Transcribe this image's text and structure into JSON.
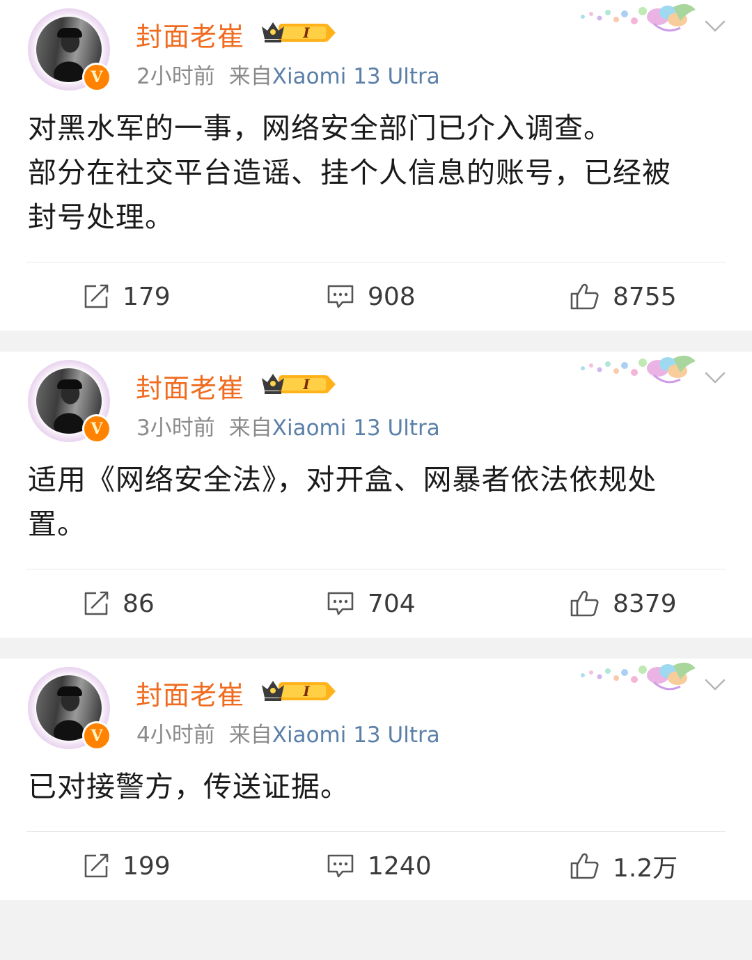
{
  "posts": [
    {
      "user_name": "封面老崔",
      "time": "2小时前",
      "from_label": "来自",
      "source": "Xiaomi 13 Ultra",
      "verified": "V",
      "vip_level": "I",
      "text_lines": [
        "对黑水军的一事，网络安全部门已介入调查。",
        "部分在社交平台造谣、挂个人信息的账号，已经被",
        "封号处理。"
      ],
      "reposts": "179",
      "comments": "908",
      "likes": "8755"
    },
    {
      "user_name": "封面老崔",
      "time": "3小时前",
      "from_label": "来自",
      "source": "Xiaomi 13 Ultra",
      "verified": "V",
      "vip_level": "I",
      "text_lines": [
        "适用《网络安全法》，对开盒、网暴者依法依规处",
        "置。"
      ],
      "reposts": "86",
      "comments": "704",
      "likes": "8379"
    },
    {
      "user_name": "封面老崔",
      "time": "4小时前",
      "from_label": "来自",
      "source": "Xiaomi 13 Ultra",
      "verified": "V",
      "vip_level": "I",
      "text_lines": [
        "已对接警方，传送证据。"
      ],
      "reposts": "199",
      "comments": "1240",
      "likes": "1.2万"
    }
  ],
  "icons": {
    "repost": "repost-icon",
    "comment": "comment-icon",
    "like": "like-icon",
    "dropdown": "chevron-down-icon",
    "vip": "crown-badge-icon",
    "verified": "verified-badge-icon"
  },
  "colors": {
    "username": "#f06b1f",
    "source": "#5a7fa8",
    "meta": "#8a8a8a",
    "verified": "#ff8200",
    "separator": "#f2f2f2"
  }
}
